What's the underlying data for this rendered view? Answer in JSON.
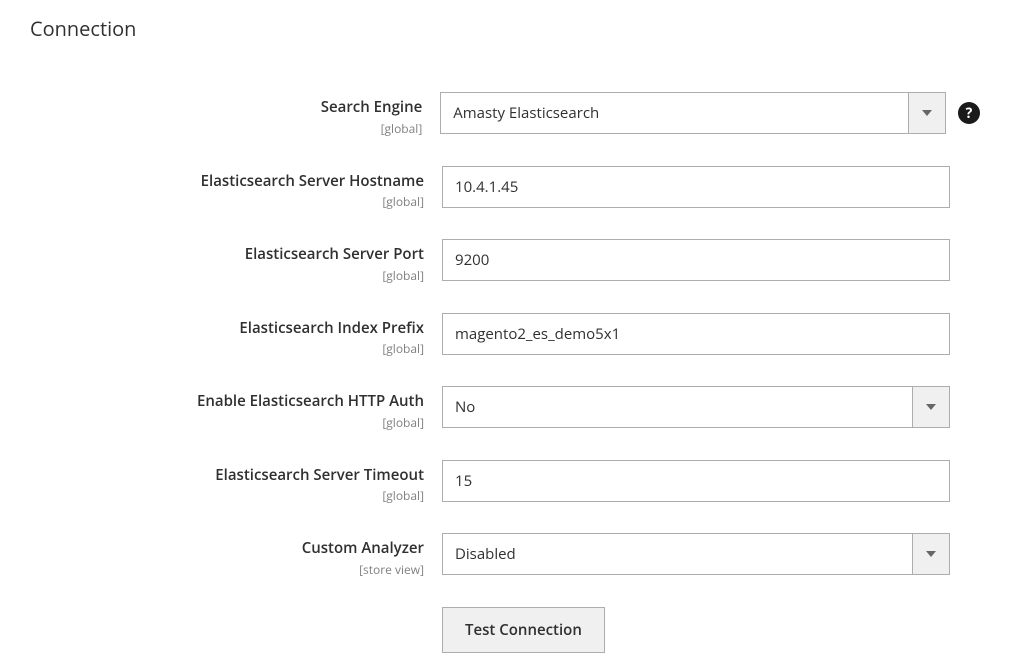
{
  "section": {
    "title": "Connection"
  },
  "fields": {
    "search_engine": {
      "label": "Search Engine",
      "scope": "[global]",
      "value": "Amasty Elasticsearch"
    },
    "hostname": {
      "label": "Elasticsearch Server Hostname",
      "scope": "[global]",
      "value": "10.4.1.45"
    },
    "port": {
      "label": "Elasticsearch Server Port",
      "scope": "[global]",
      "value": "9200"
    },
    "index_prefix": {
      "label": "Elasticsearch Index Prefix",
      "scope": "[global]",
      "value": "magento2_es_demo5x1"
    },
    "http_auth": {
      "label": "Enable Elasticsearch HTTP Auth",
      "scope": "[global]",
      "value": "No"
    },
    "timeout": {
      "label": "Elasticsearch Server Timeout",
      "scope": "[global]",
      "value": "15"
    },
    "custom_analyzer": {
      "label": "Custom Analyzer",
      "scope": "[store view]",
      "value": "Disabled"
    }
  },
  "buttons": {
    "test_connection": "Test Connection"
  },
  "icons": {
    "help": "?"
  }
}
